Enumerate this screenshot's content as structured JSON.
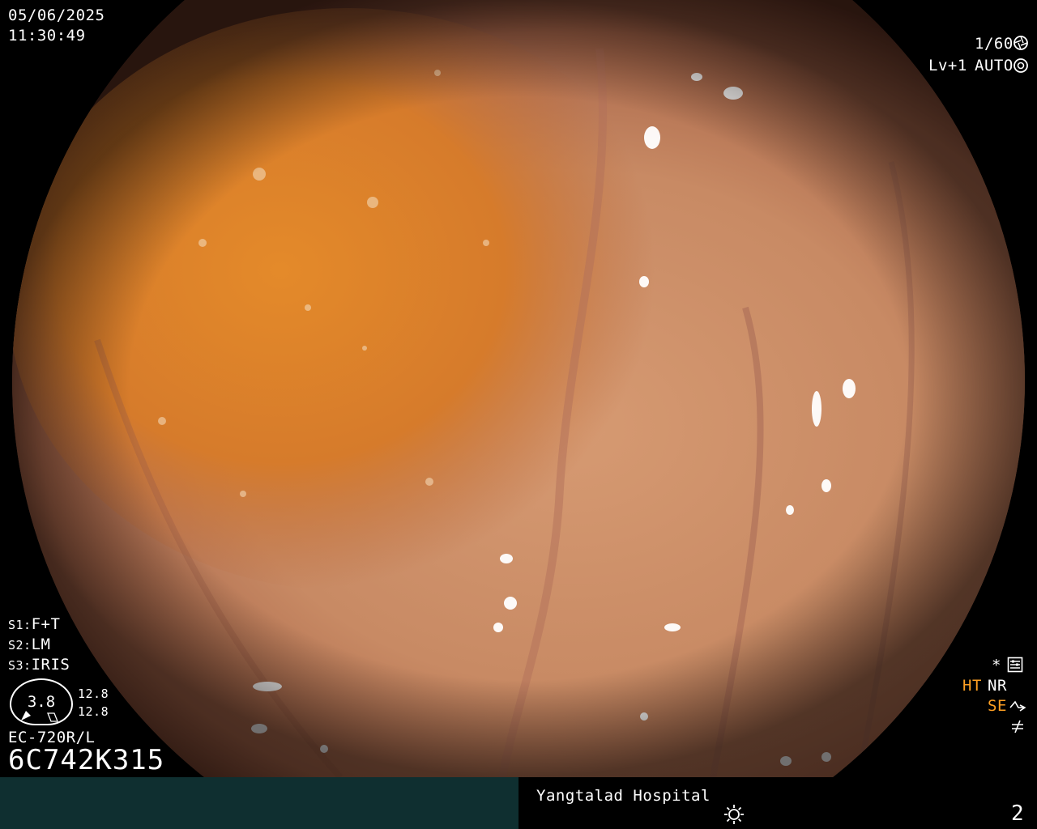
{
  "overlay": {
    "date": "05/06/2025",
    "time": "11:30:49",
    "shutter": "1/60",
    "level": "Lv+1",
    "auto": "AUTO",
    "s1_key": "S1:",
    "s1_val": "F+T",
    "s2_key": "S2:",
    "s2_val": "LM",
    "s3_key": "S3:",
    "s3_val": "IRIS",
    "gauge_value": "3.8",
    "gauge_top": "12.8",
    "gauge_bottom": "12.8",
    "scope_model": "EC-720R/L",
    "serial": "6C742K315",
    "asterisk": "*",
    "ht": "HT",
    "nr": "NR",
    "se": "SE"
  },
  "footer": {
    "hospital": "Yangtalad Hospital",
    "page_number": "2"
  },
  "colors": {
    "text": "#ffffff",
    "highlight": "#ffa023",
    "footer_left_bg": "#0f2f30"
  },
  "icons": [
    "shutter-icon",
    "auto-iris-icon",
    "settings-icon",
    "structure-enhance-icon",
    "freeze-icon",
    "brightness-icon"
  ]
}
